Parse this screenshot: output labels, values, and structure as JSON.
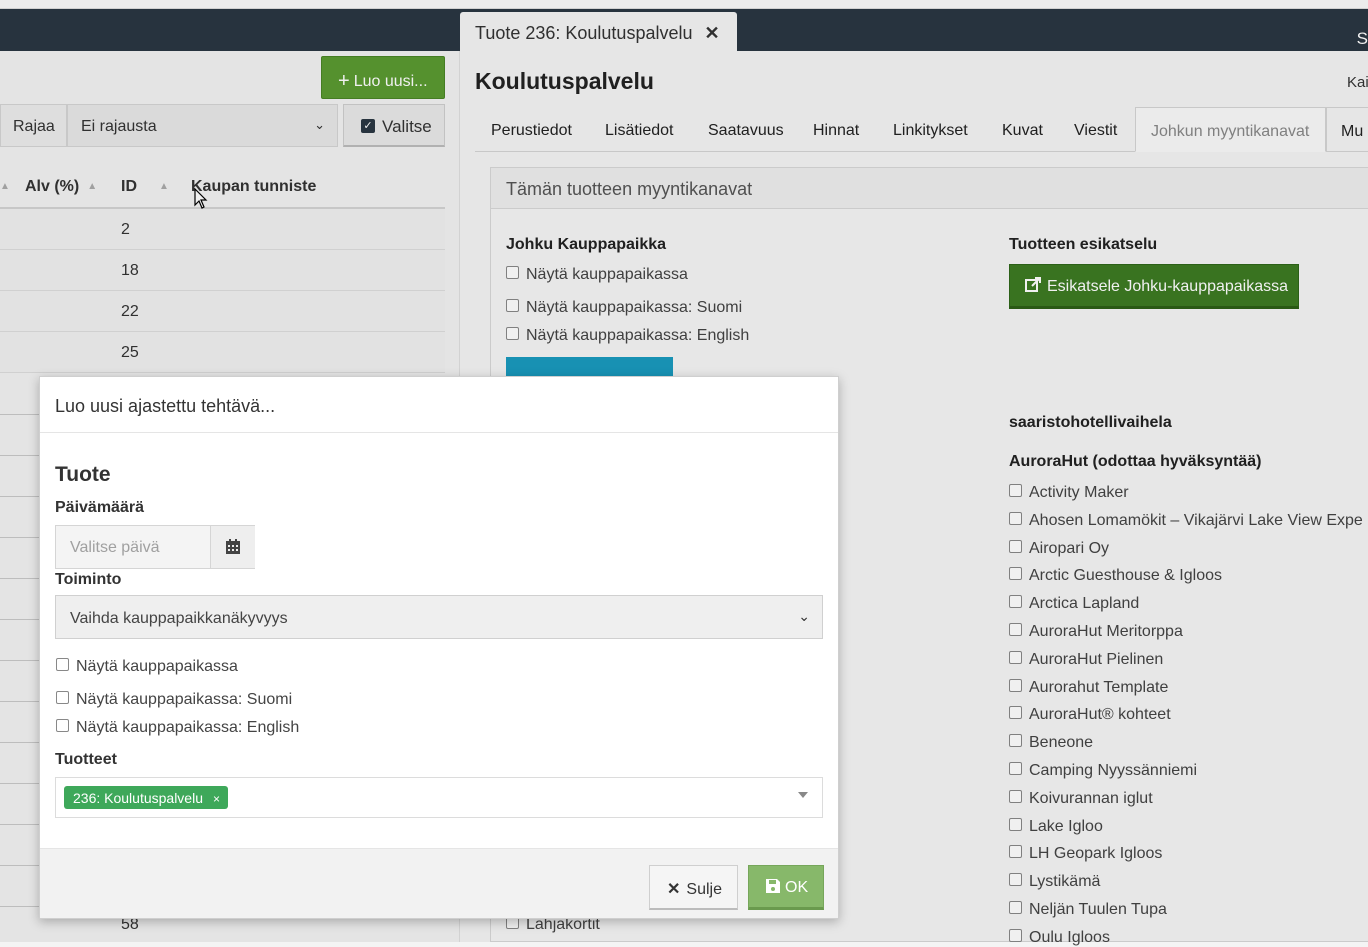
{
  "appbar": {
    "right_text": "S"
  },
  "list": {
    "create_button": "Luo uusi...",
    "filter_label": "Rajaa",
    "filter_value": "Ei rajausta",
    "select_button": "Valitse",
    "columns": [
      "Alv (%)",
      "ID",
      "Kaupan tunniste"
    ],
    "row_ids": [
      "2",
      "18",
      "22",
      "25"
    ],
    "bottom_id": "58"
  },
  "product": {
    "tab_title": "Tuote 236: Koulutuspalvelu",
    "title": "Koulutuspalvelu",
    "right_text": "Kai",
    "tabs": [
      "Perustiedot",
      "Lisätiedot",
      "Saatavuus",
      "Hinnat",
      "Linkitykset",
      "Kuvat",
      "Viestit",
      "Johkun myyntikanavat",
      "Mu"
    ],
    "channels_header": "Tämän tuotteen myyntikanavat",
    "marketplace": {
      "title": "Johku Kauppapaikka",
      "options": [
        "Näytä kauppapaikassa",
        "Näytä kauppapaikassa: Suomi",
        "Näytä kauppapaikassa: English"
      ]
    },
    "preview": {
      "title": "Tuotteen esikatselu",
      "button": "Esikatsele Johku-kauppapaikassa"
    },
    "partner_title": "saaristohotellivaihela",
    "auroraHut": {
      "title": "AuroraHut (odottaa hyväksyntää)",
      "items": [
        "Activity Maker",
        "Ahosen Lomamökit – Vikajärvi Lake View Expe",
        "Airopari Oy",
        "Arctic Guesthouse & Igloos",
        "Arctica Lapland",
        "AuroraHut Meritorppa",
        "AuroraHut Pielinen",
        "Aurorahut Template",
        "AuroraHut® kohteet",
        "Beneone",
        "Camping Nyyssänniemi",
        "Koivurannan iglut",
        "Lake Igloo",
        "LH Geopark Igloos",
        "Lystikämä",
        "Neljän Tuulen Tupa",
        "Oulu Igloos"
      ]
    },
    "lahjakortit": "Lahjakortit"
  },
  "modal": {
    "title": "Luo uusi ajastettu tehtävä...",
    "section": "Tuote",
    "date_label": "Päivämäärä",
    "date_placeholder": "Valitse päivä",
    "action_label": "Toiminto",
    "action_value": "Vaihda kauppapaikkanäkyvyys",
    "options": [
      "Näytä kauppapaikassa",
      "Näytä kauppapaikassa: Suomi",
      "Näytä kauppapaikassa: English"
    ],
    "products_label": "Tuotteet",
    "product_tag": "236: Koulutuspalvelu",
    "close_button": "Sulje",
    "ok_button": "OK"
  }
}
